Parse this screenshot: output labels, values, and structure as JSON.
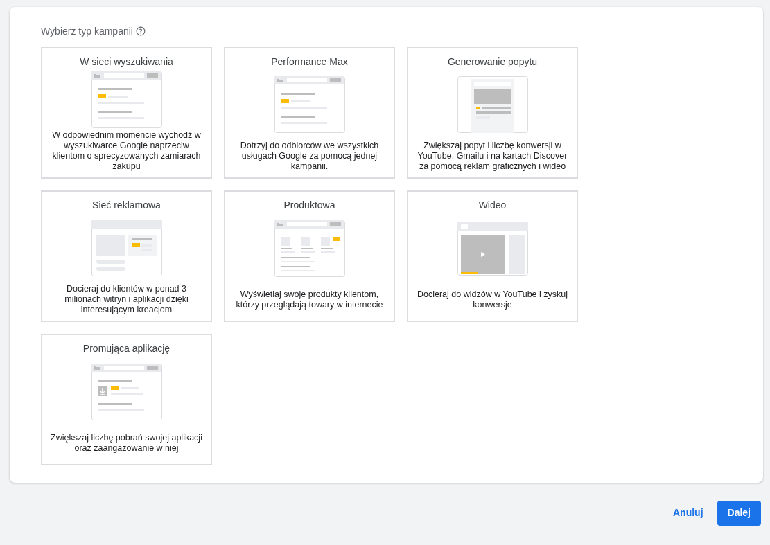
{
  "heading": "Wybierz typ kampanii",
  "campaign_types": [
    {
      "kind": "search",
      "title": "W sieci wyszukiwania",
      "description": "W odpowiednim momencie wychodź w wyszukiwarce Google naprzeciw klientom o sprecyzowanych zamiarach zakupu"
    },
    {
      "kind": "pmax",
      "title": "Performance Max",
      "description": "Dotrzyj do odbiorców we wszystkich usługach Google za pomocą jednej kampanii."
    },
    {
      "kind": "demand",
      "title": "Generowanie popytu",
      "description": "Zwiększaj popyt i liczbę konwersji w YouTube, Gmailu i na kartach Discover za pomocą reklam graficznych i wideo"
    },
    {
      "kind": "display",
      "title": "Sieć reklamowa",
      "description": "Docieraj do klientów w ponad 3 milionach witryn i aplikacji dzięki interesującym kreacjom"
    },
    {
      "kind": "shopping",
      "title": "Produktowa",
      "description": "Wyświetlaj swoje produkty klientom, którzy przeglądają towary w internecie"
    },
    {
      "kind": "video",
      "title": "Wideo",
      "description": "Docieraj do widzów w YouTube i zyskuj konwersje"
    },
    {
      "kind": "app",
      "title": "Promująca aplikację",
      "description": "Zwiększaj liczbę pobrań swojej aplikacji oraz zaangażowanie w niej"
    }
  ],
  "buttons": {
    "cancel": "Anuluj",
    "next": "Dalej"
  }
}
